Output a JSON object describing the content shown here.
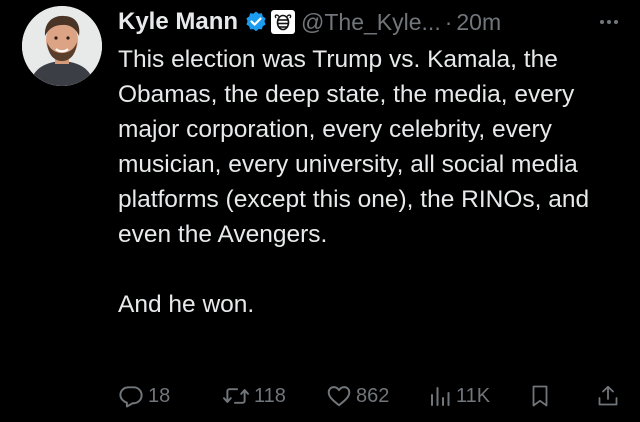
{
  "tweet": {
    "author_name": "Kyle Mann",
    "handle": "@The_Kyle...",
    "separator": "·",
    "time": "20m",
    "body_paragraphs": [
      "This election was Trump vs. Kamala, the Obamas, the deep state, the media, every major corporation, every celebrity, every musician, every university, all social media platforms (except this one), the RINOs, and even the Avengers.",
      "And he won."
    ],
    "verified_icon": "verified-badge-icon",
    "affiliate_icon": "babylon-bee-affiliate-icon"
  },
  "actions": {
    "replies": "18",
    "reposts": "118",
    "likes": "862",
    "views": "11K"
  },
  "colors": {
    "background": "#000000",
    "text_primary": "#e7e9ea",
    "text_secondary": "#71767b",
    "verified_blue": "#1d9bf0"
  }
}
